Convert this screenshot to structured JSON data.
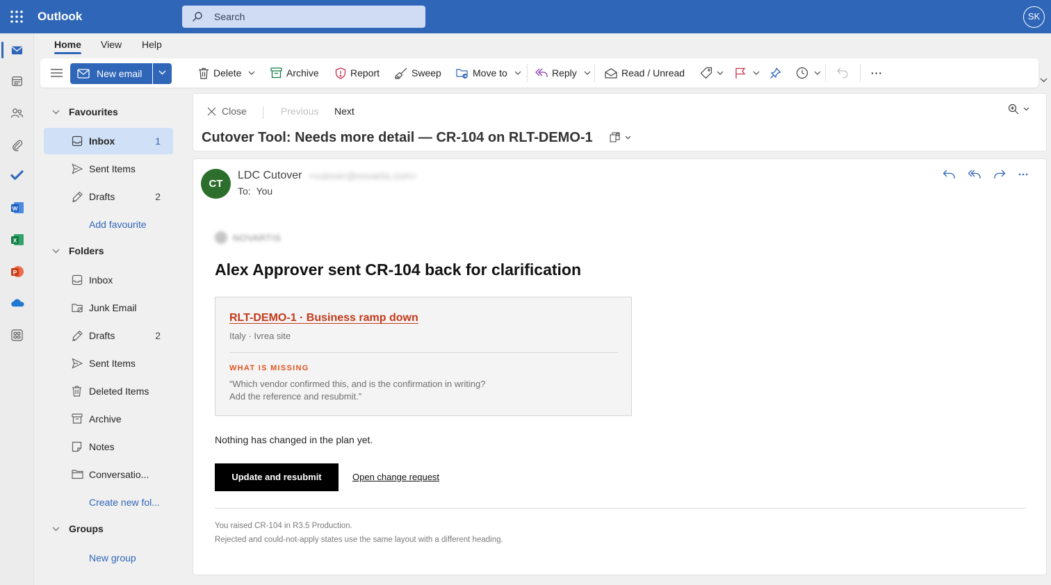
{
  "header": {
    "app_name": "Outlook",
    "search_placeholder": "Search",
    "user_initials": "SK"
  },
  "tabs": [
    {
      "label": "Home",
      "active": true
    },
    {
      "label": "View",
      "active": false
    },
    {
      "label": "Help",
      "active": false
    }
  ],
  "ribbon": {
    "new_email": "New email",
    "delete": "Delete",
    "archive": "Archive",
    "report": "Report",
    "sweep": "Sweep",
    "move_to": "Move to",
    "reply": "Reply",
    "read_unread": "Read / Unread",
    "more": "···"
  },
  "folders": {
    "favourites_heading": "Favourites",
    "favourites": [
      {
        "label": "Inbox",
        "count": "1",
        "selected": true
      },
      {
        "label": "Sent Items",
        "count": ""
      },
      {
        "label": "Drafts",
        "count": "2"
      }
    ],
    "add_favourite": "Add favourite",
    "folders_heading": "Folders",
    "items": [
      {
        "label": "Inbox",
        "count": ""
      },
      {
        "label": "Junk Email",
        "count": ""
      },
      {
        "label": "Drafts",
        "count": "2"
      },
      {
        "label": "Sent Items",
        "count": ""
      },
      {
        "label": "Deleted Items",
        "count": ""
      },
      {
        "label": "Archive",
        "count": ""
      },
      {
        "label": "Notes",
        "count": ""
      },
      {
        "label": "Conversatio...",
        "count": ""
      }
    ],
    "create_folder": "Create new fol...",
    "groups_heading": "Groups",
    "new_group": "New group"
  },
  "reading_pane": {
    "close": "Close",
    "previous": "Previous",
    "next": "Next",
    "subject": "Cutover Tool: Needs more detail — CR-104 on RLT-DEMO-1"
  },
  "message": {
    "sender_initials": "CT",
    "sender_name": "LDC Cutover",
    "sender_email": "<cutover@novartis.com>",
    "to_label": "To:",
    "to_value": "You",
    "brand_name": "NOVARTIS",
    "headline": "Alex Approver sent CR-104 back for clarification",
    "card_title": "RLT-DEMO-1 · Business ramp down",
    "card_subtitle": "Italy · Ivrea site",
    "missing_label": "WHAT IS MISSING",
    "missing_quote_line1": "“Which vendor confirmed this, and is the confirmation in writing?",
    "missing_quote_line2": "Add the reference and resubmit.”",
    "status_text": "Nothing has changed in the plan yet.",
    "primary_button": "Update and resubmit",
    "secondary_link": "Open change request",
    "footer_line1": "You raised CR-104 in R3.5 Production.",
    "footer_line2": "Rejected and could-not-apply states use the same layout with a different heading."
  },
  "colors": {
    "brand_blue": "#2f66b8",
    "avatar_green": "#2c6e2c",
    "card_title_red": "#c4391a",
    "missing_orange": "#e0541e"
  }
}
